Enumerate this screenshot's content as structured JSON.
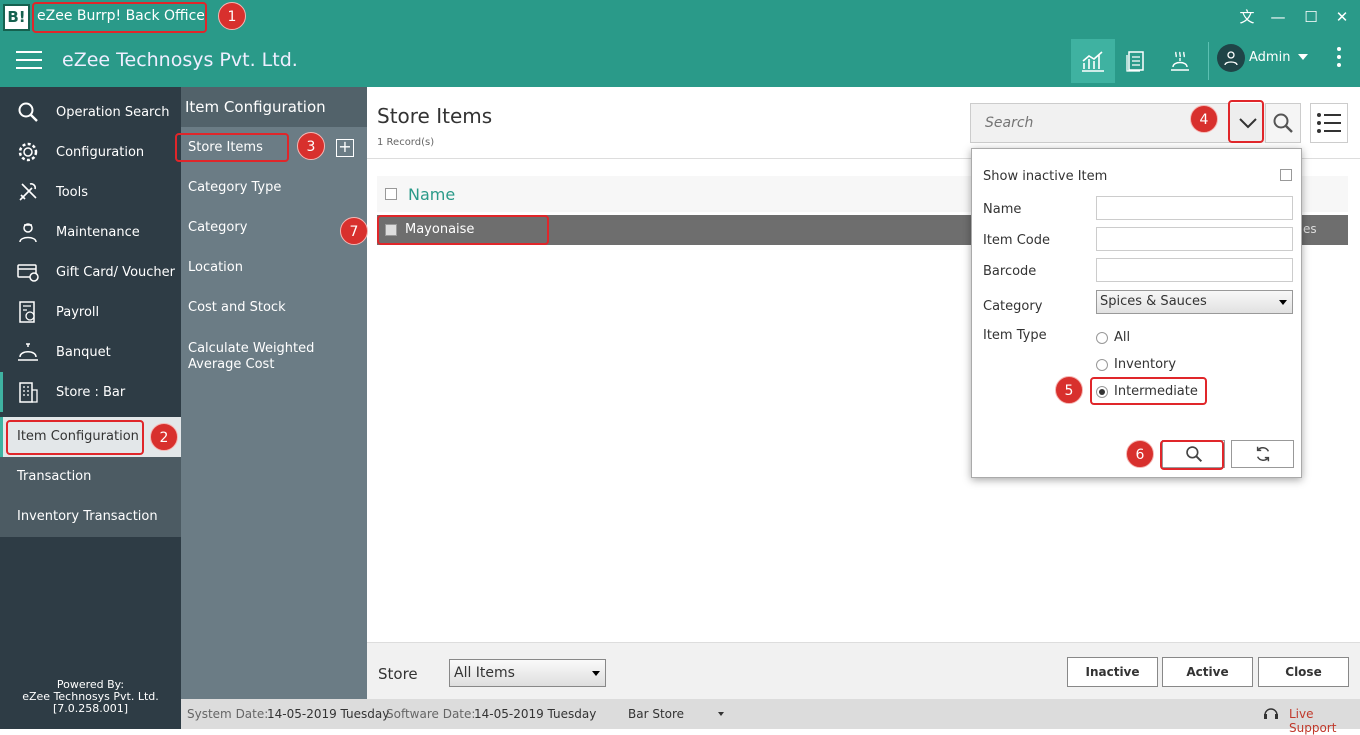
{
  "window": {
    "logo_text": "B!",
    "title": "eZee Burrp! Back Office",
    "translate_glyph": "文",
    "minimize": "—",
    "maximize": "☐",
    "close": "✕"
  },
  "header": {
    "company": "eZee Technosys Pvt. Ltd.",
    "user": "Admin"
  },
  "sidebar": {
    "items": [
      {
        "label": "Operation Search",
        "icon": "search-icon"
      },
      {
        "label": "Configuration",
        "icon": "gear-icon"
      },
      {
        "label": "Tools",
        "icon": "tools-icon"
      },
      {
        "label": "Maintenance",
        "icon": "maintenance-icon"
      },
      {
        "label": "Gift Card/ Voucher",
        "icon": "gift-card-icon"
      },
      {
        "label": "Payroll",
        "icon": "payroll-icon"
      },
      {
        "label": "Banquet",
        "icon": "banquet-icon"
      },
      {
        "label": "Store : Bar",
        "icon": "store-icon"
      }
    ],
    "sub_items": [
      "Item Configuration",
      "Transaction",
      "Inventory Transaction"
    ],
    "powered_by": [
      "Powered By:",
      "eZee Technosys Pvt. Ltd.",
      "[7.0.258.001]"
    ]
  },
  "panel2": {
    "title": "Item Configuration",
    "items": [
      "Store Items",
      "Category Type",
      "Category",
      "Location",
      "Cost and Stock",
      "Calculate Weighted Average Cost"
    ],
    "plus": "+"
  },
  "main": {
    "title": "Store Items",
    "record_count": "1 Record(s)",
    "search_placeholder": "Search",
    "column_name": "Name",
    "rows": [
      {
        "name": "Mayonaise",
        "tail": "es"
      }
    ]
  },
  "filter": {
    "show_inactive": "Show inactive Item",
    "name": "Name",
    "item_code": "Item Code",
    "barcode": "Barcode",
    "category": "Category",
    "category_value": "Spices & Sauces",
    "item_type": "Item Type",
    "types": [
      "All",
      "Inventory",
      "Intermediate"
    ],
    "selected_type": "Intermediate"
  },
  "footer": {
    "store_label": "Store",
    "store_value": "All Items",
    "inactive": "Inactive",
    "active": "Active",
    "close": "Close"
  },
  "status": {
    "system_date_label": "System Date:",
    "system_date": "14-05-2019 Tuesday",
    "software_date_label": "Software Date:",
    "software_date": "14-05-2019 Tuesday",
    "store": "Bar Store",
    "live_support": "Live Support"
  },
  "badges": [
    "1",
    "2",
    "3",
    "4",
    "5",
    "6",
    "7"
  ],
  "colors": {
    "accent": "#2a9a89",
    "sidebar": "#2e3c45",
    "callout": "#e0262a"
  }
}
